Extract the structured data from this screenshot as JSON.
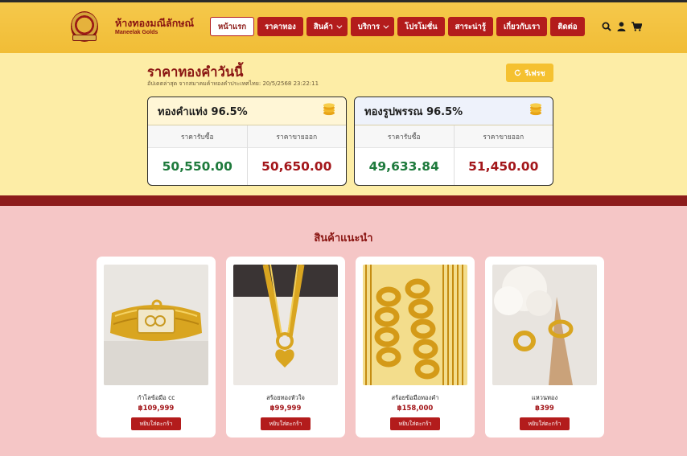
{
  "brand": {
    "name_th": "ห้างทองมณีลักษณ์",
    "name_en": "Maneelak Golds"
  },
  "nav": {
    "items": [
      {
        "label": "หน้าแรก",
        "active": true,
        "dropdown": false
      },
      {
        "label": "ราคาทอง",
        "active": false,
        "dropdown": false
      },
      {
        "label": "สินค้า",
        "active": false,
        "dropdown": true
      },
      {
        "label": "บริการ",
        "active": false,
        "dropdown": true
      },
      {
        "label": "โปรโมชั่น",
        "active": false,
        "dropdown": false
      },
      {
        "label": "สาระน่ารู้",
        "active": false,
        "dropdown": false
      },
      {
        "label": "เกี่ยวกับเรา",
        "active": false,
        "dropdown": false
      },
      {
        "label": "ติดต่อ",
        "active": false,
        "dropdown": false
      }
    ],
    "icons": [
      "search-icon",
      "user-icon",
      "cart-icon"
    ]
  },
  "gold_price": {
    "title": "ราคาทองคำวันนี้",
    "updated": "อัปเดตล่าสุด จากสมาคมค้าทองคำประเทศไทย: 20/5/2568 23:22:11",
    "refresh_label": "รีเฟรช",
    "cards": [
      {
        "title": "ทองคำแท่ง 96.5%",
        "buy_label": "ราคารับซื้อ",
        "sell_label": "ราคาขายออก",
        "buy_value": "50,550.00",
        "sell_value": "50,650.00"
      },
      {
        "title": "ทองรูปพรรณ 96.5%",
        "buy_label": "ราคารับซื้อ",
        "sell_label": "ราคาขายออก",
        "buy_value": "49,633.84",
        "sell_value": "51,450.00"
      }
    ]
  },
  "products": {
    "title": "สินค้าแนะนำ",
    "items": [
      {
        "name": "กำไลข้อมือ cc",
        "price": "฿109,999",
        "button": "หยิบใส่ตะกร้า"
      },
      {
        "name": "สร้อยทองหัวใจ",
        "price": "฿99,999",
        "button": "หยิบใส่ตะกร้า"
      },
      {
        "name": "สร้อยข้อมือทองคำ",
        "price": "฿158,000",
        "button": "หยิบใส่ตะกร้า"
      },
      {
        "name": "แหวนทอง",
        "price": "฿399",
        "button": "หยิบใส่ตะกร้า"
      }
    ]
  },
  "colors": {
    "brand_red": "#b31c1c",
    "header_gold": "#f5c84b",
    "price_bg": "#fdeda6",
    "products_bg": "#f5c6c6",
    "buy_green": "#1e7a3c",
    "sell_red": "#a3161a"
  }
}
